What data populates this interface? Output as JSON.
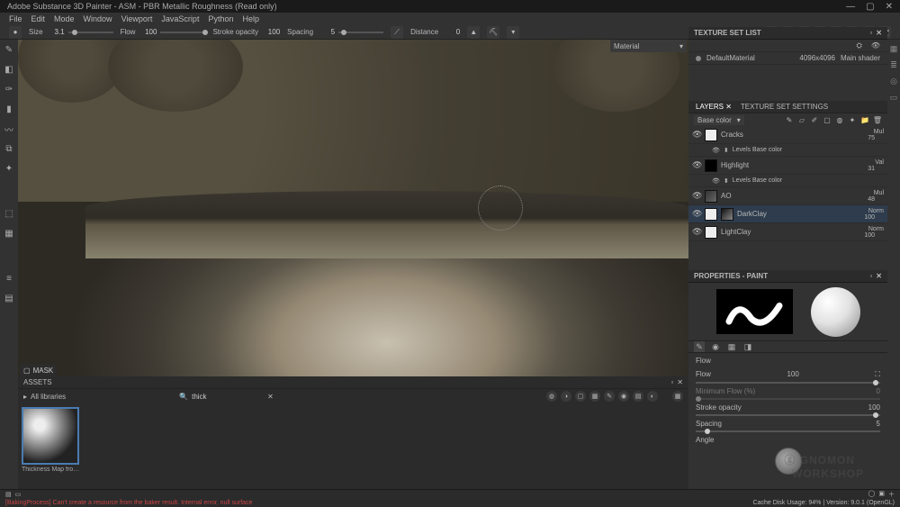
{
  "title": "Adobe Substance 3D Painter - ASM - PBR Metallic Roughness (Read only)",
  "menu": [
    "File",
    "Edit",
    "Mode",
    "Window",
    "Viewport",
    "JavaScript",
    "Python",
    "Help"
  ],
  "toolbar": {
    "size_label": "Size",
    "size_val": "3.1",
    "flow_label": "Flow",
    "flow_val": "100",
    "opacity_label": "Stroke opacity",
    "opacity_val": "100",
    "spacing_label": "Spacing",
    "spacing_val": "5",
    "distance_label": "Distance",
    "distance_val": "0",
    "material_label": "Material"
  },
  "viewport": {
    "mask_label": "MASK"
  },
  "texset": {
    "title": "TEXTURE SET LIST",
    "item": "DefaultMaterial",
    "res": "4096x4096",
    "shader": "Main shader"
  },
  "layers": {
    "tab1": "LAYERS",
    "tab2": "TEXTURE SET SETTINGS",
    "channel": "Base color",
    "items": [
      {
        "name": "Cracks",
        "blend": "Mul",
        "opacity": "75",
        "sub": "Levels  Base color"
      },
      {
        "name": "Highlight",
        "blend": "Val",
        "opacity": "31",
        "sub": "Levels  Base color"
      },
      {
        "name": "AO",
        "blend": "Mul",
        "opacity": "48"
      },
      {
        "name": "DarkClay",
        "blend": "Norm",
        "opacity": "100"
      },
      {
        "name": "LightClay",
        "blend": "Norm",
        "opacity": "100"
      }
    ]
  },
  "properties": {
    "title": "PROPERTIES - PAINT",
    "flow_sec": "Flow",
    "flow_label": "Flow",
    "flow_val": "100",
    "min_flow": "Minimum Flow (%)",
    "min_flow_val": "0",
    "opacity_label": "Stroke opacity",
    "opacity_val": "100",
    "spacing_label": "Spacing",
    "spacing_val": "5",
    "angle_label": "Angle"
  },
  "assets": {
    "title": "ASSETS",
    "lib": "All libraries",
    "search": "thick",
    "item": "Thickness Map from..."
  },
  "status": {
    "error": "[BakingProcess] Can't create a resource from the baker result. Internal error, null surface",
    "cache": "Cache Disk Usage:   94%",
    "version": "Version: 9.0.1 (OpenGL)"
  }
}
